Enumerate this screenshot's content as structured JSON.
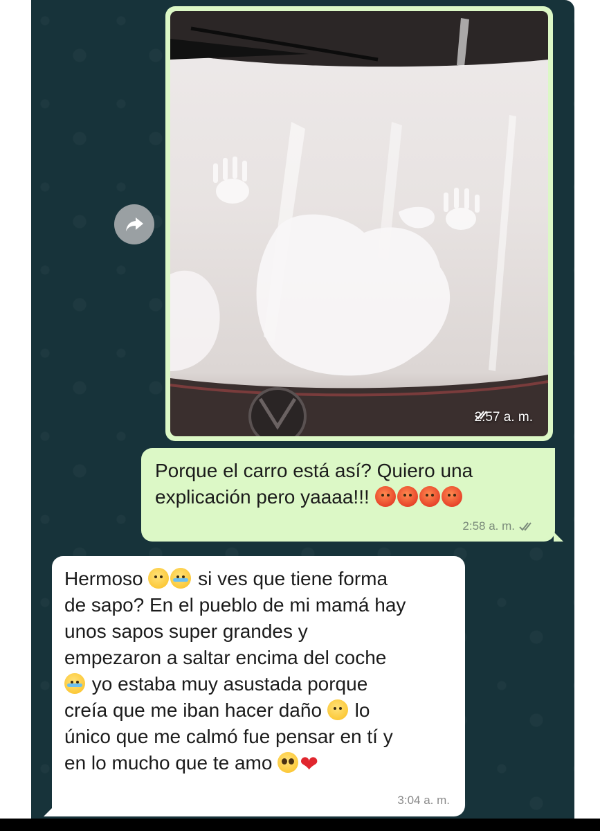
{
  "messages": [
    {
      "type": "image",
      "direction": "outgoing",
      "time": "2:57 a. m.",
      "status_icon": "double-check-icon"
    },
    {
      "type": "text",
      "direction": "outgoing",
      "lines": [
        "Porque el carro está así? Quiero una",
        "explicación pero yaaaa!!!"
      ],
      "emojis": [
        "angry-face",
        "angry-face",
        "angry-face",
        "angry-face"
      ],
      "time": "2:58 a. m.",
      "status_icon": "double-check-icon"
    },
    {
      "type": "text",
      "direction": "incoming",
      "segments": {
        "l1a": "Hermoso",
        "l1b": "si ves que tiene forma",
        "l2": "de sapo? En el pueblo de mi mamá hay",
        "l3": "unos sapos super grandes y",
        "l4": "empezaron a saltar encima del coche",
        "l5": "yo estaba muy asustada porque",
        "l6a": "creía que me iban hacer daño",
        "l6b": "lo",
        "l7": "único que me calmó fue pensar en tí y",
        "l8": "en lo mucho que te amo"
      },
      "time": "3:04 a. m."
    }
  ],
  "forward_button_icon": "forward-arrow-icon",
  "colors": {
    "chat_background": "#17333a",
    "outgoing_bubble": "#dcf8c6",
    "incoming_bubble": "#ffffff"
  }
}
